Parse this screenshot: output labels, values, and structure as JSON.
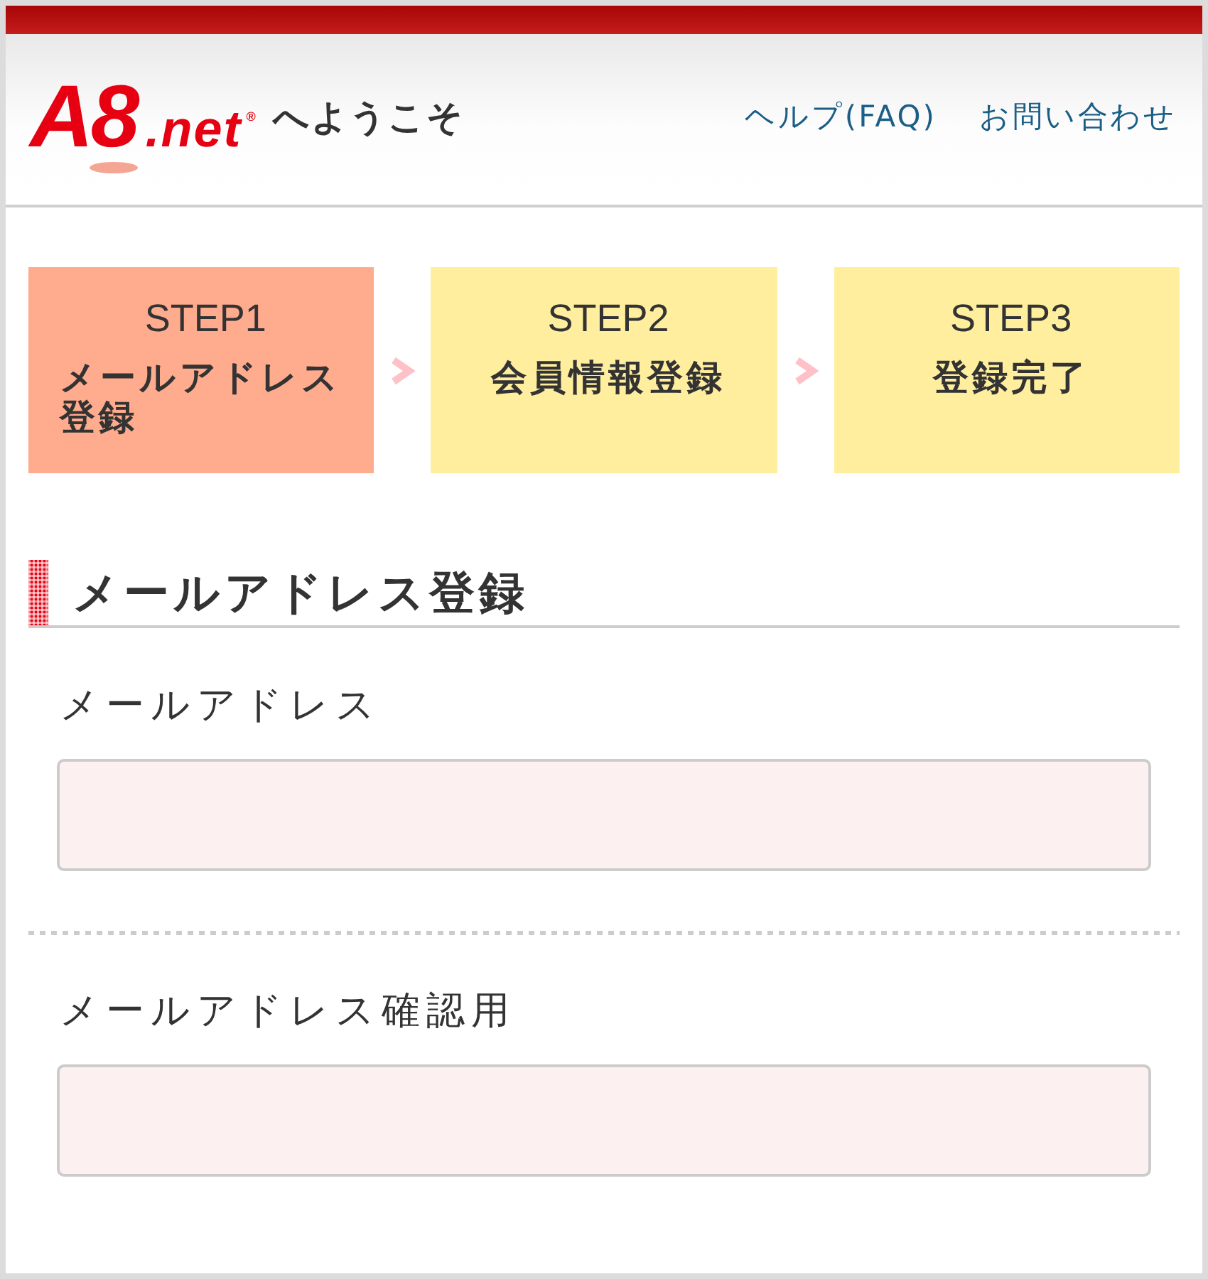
{
  "header": {
    "logo": {
      "mark": "A8",
      "suffix": ".net",
      "registered": "®"
    },
    "welcome": "へようこそ",
    "links": [
      "ヘルプ(FAQ)",
      "お問い合わせ"
    ]
  },
  "steps": [
    {
      "label": "STEP1",
      "title": "メールアドレス登録",
      "selected": true
    },
    {
      "label": "STEP2",
      "title": "会員情報登録",
      "selected": false
    },
    {
      "label": "STEP3",
      "title": "登録完了",
      "selected": false
    }
  ],
  "section": {
    "title": "メールアドレス登録"
  },
  "fields": [
    {
      "label": "メールアドレス"
    },
    {
      "label": "メールアドレス確認用"
    }
  ]
}
